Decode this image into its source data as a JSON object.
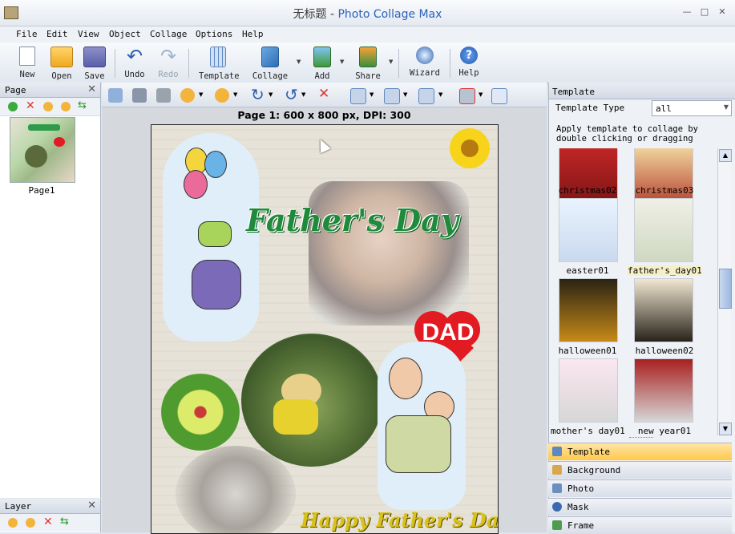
{
  "window": {
    "title_chinese": "无标题",
    "title_separator": " - ",
    "title_app": "Photo Collage Max"
  },
  "menu": [
    "File",
    "Edit",
    "View",
    "Object",
    "Collage",
    "Options",
    "Help"
  ],
  "toolbar": {
    "new": "New",
    "open": "Open",
    "save": "Save",
    "undo": "Undo",
    "redo": "Redo",
    "template": "Template",
    "collage": "Collage",
    "add": "Add",
    "share": "Share",
    "wizard": "Wizard",
    "help": "Help"
  },
  "page_panel": {
    "title": "Page",
    "pages": [
      "Page1"
    ]
  },
  "layer_panel": {
    "title": "Layer"
  },
  "canvas": {
    "page_label": "Page 1: 600 x 800 px, DPI: 300",
    "title_text": "Father's Day",
    "heart_text": "DAD",
    "bottom_text": "Happy Father's Day"
  },
  "template_panel": {
    "title": "Template",
    "type_label": "Template Type",
    "type_value": "all",
    "hint": "Apply template to collage by double clicking or dragging",
    "items": [
      "christmas02",
      "christmas03",
      "easter01",
      "father's_day01",
      "halloween01",
      "halloween02",
      "mother's_day01",
      "new_year01"
    ]
  },
  "bottom_tabs": [
    "Template",
    "Background",
    "Photo",
    "Mask",
    "Frame"
  ],
  "colors": {
    "accent": "#2a63b8",
    "tab_active": "#ffc84a",
    "title_green": "#1f8a3a",
    "heart": "#e21b23"
  }
}
